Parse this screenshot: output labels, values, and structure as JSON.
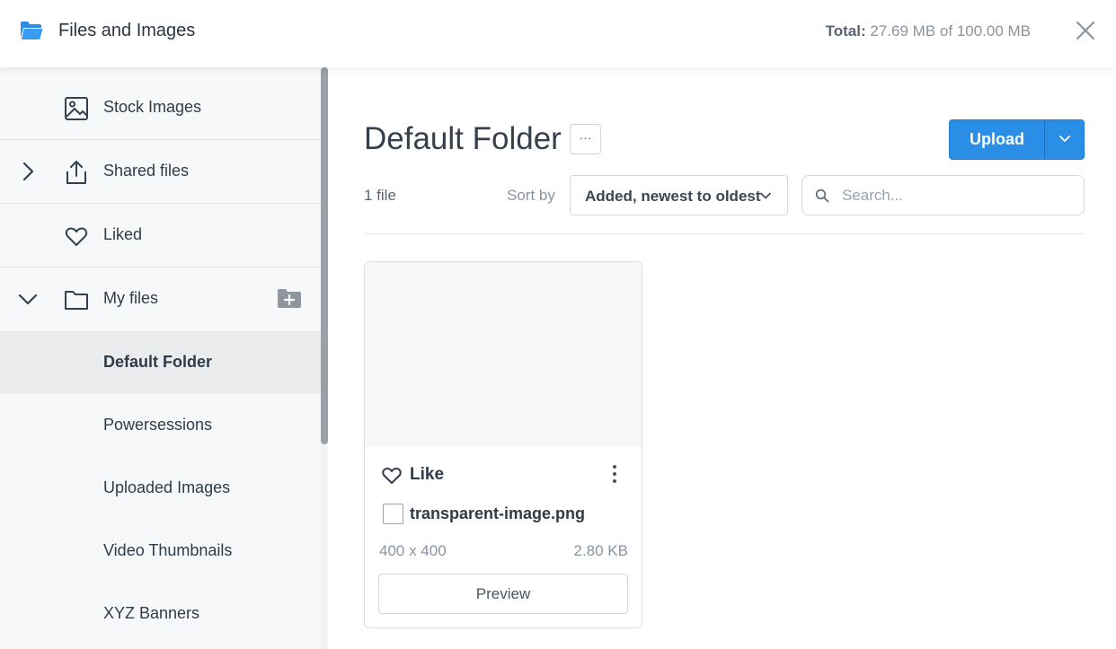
{
  "header": {
    "title": "Files and Images",
    "total_label": "Total:",
    "total_value": "27.69 MB of 100.00 MB",
    "icons": {
      "app": "folder-open-icon",
      "close": "close-icon"
    },
    "accent": "#2a8ee6"
  },
  "sidebar": {
    "stock": {
      "label": "Stock Images",
      "icon": "image-icon"
    },
    "shared": {
      "label": "Shared files",
      "icon": "share-upload-icon"
    },
    "liked": {
      "label": "Liked",
      "icon": "heart-icon"
    },
    "myfiles": {
      "label": "My files",
      "icon": "folder-icon"
    },
    "folders": [
      {
        "label": "Default Folder",
        "active": true
      },
      {
        "label": "Powersessions"
      },
      {
        "label": "Uploaded Images"
      },
      {
        "label": "Video Thumbnails"
      },
      {
        "label": "XYZ Banners"
      }
    ]
  },
  "main": {
    "title": "Default Folder",
    "more_label": "···",
    "upload_label": "Upload",
    "file_count": "1 file",
    "sort_label": "Sort by",
    "sort_value": "Added, newest to oldest",
    "search_placeholder": "Search...",
    "files": [
      {
        "like_label": "Like",
        "name": "transparent-image.png",
        "dimensions": "400 x 400",
        "size": "2.80 KB",
        "preview_label": "Preview"
      }
    ]
  }
}
